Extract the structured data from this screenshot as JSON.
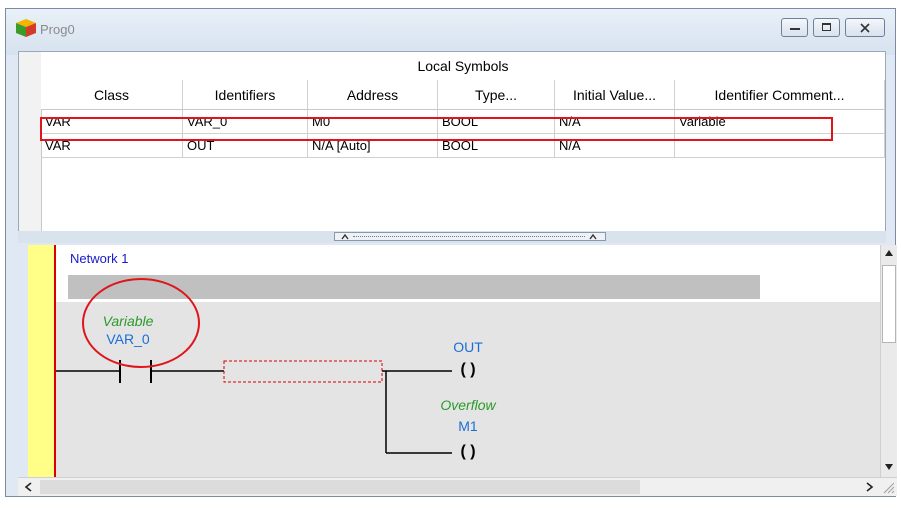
{
  "window": {
    "title": "Prog0",
    "buttons": {
      "minimize": "minimize-icon",
      "maximize": "maximize-icon",
      "close": "close-icon"
    }
  },
  "symbols": {
    "header": "Local Symbols",
    "columns": [
      "Class",
      "Identifiers",
      "Address",
      "Type...",
      "Initial Value...",
      "Identifier Comment..."
    ],
    "rows": [
      [
        "VAR",
        "VAR_0",
        "M0",
        "BOOL",
        "N/A",
        "Variable"
      ],
      [
        "VAR",
        "OUT",
        "N/A [Auto]",
        "BOOL",
        "N/A",
        ""
      ]
    ]
  },
  "ladder": {
    "network_label": "Network 1",
    "contact": {
      "comment": "Variable",
      "name": "VAR_0"
    },
    "coil_out": {
      "name": "OUT",
      "symbol": "( )"
    },
    "coil_overflow": {
      "comment": "Overflow",
      "name": "M1",
      "symbol": "( )"
    }
  },
  "colors": {
    "highlight": "#e0141b",
    "identifier_blue": "#1a6fd6",
    "comment_green": "#2a9a2a",
    "rail_yellow": "#ffff88"
  }
}
